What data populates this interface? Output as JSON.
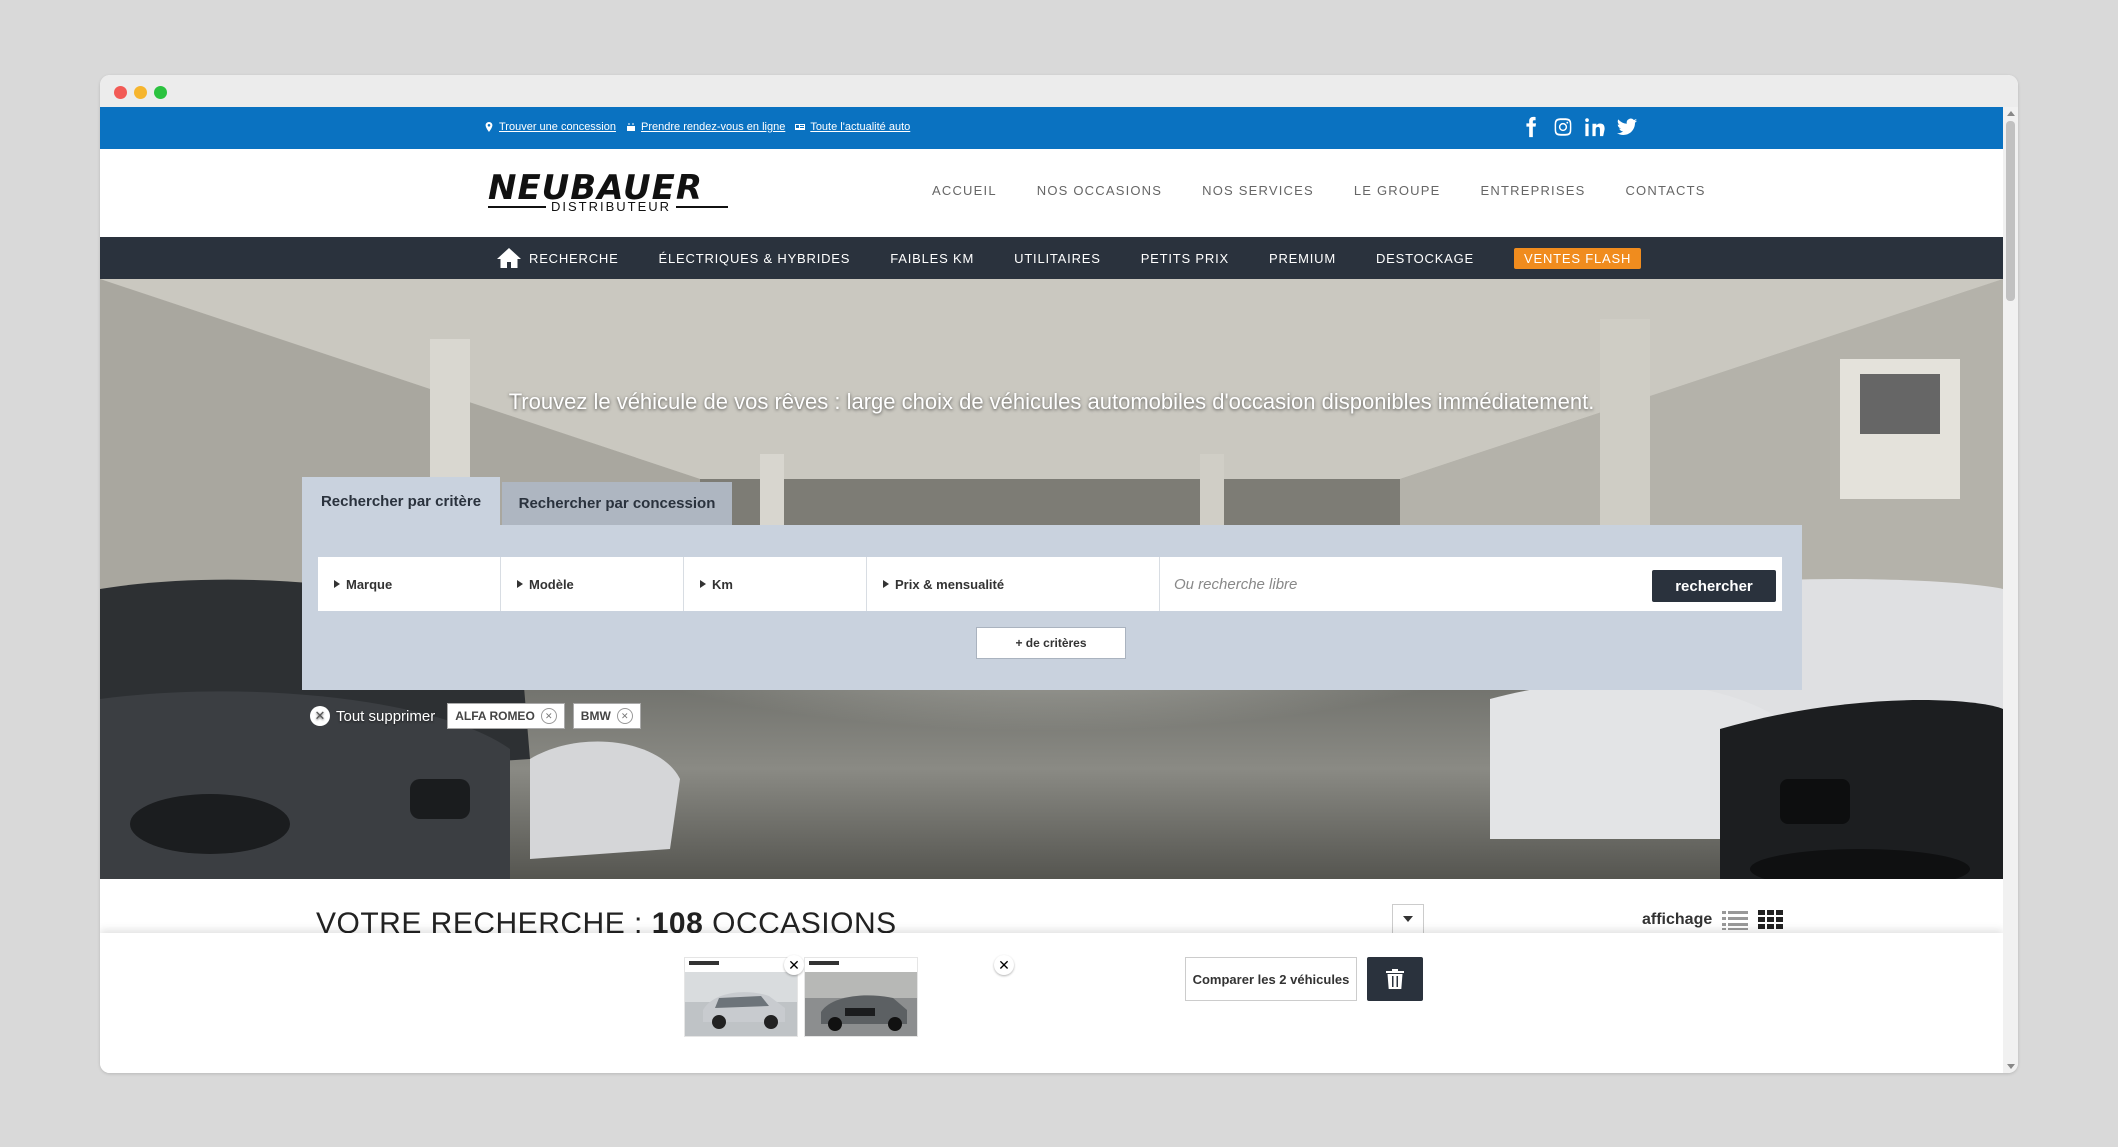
{
  "topbar": {
    "links": [
      {
        "label": "Trouver une concession",
        "icon": "map-pin-icon"
      },
      {
        "label": "Prendre rendez-vous en ligne",
        "icon": "calendar-icon"
      },
      {
        "label": "Toute l'actualité auto",
        "icon": "newspaper-icon"
      }
    ],
    "socials": [
      "facebook-icon",
      "instagram-icon",
      "linkedin-icon",
      "twitter-icon"
    ],
    "bg_color": "#0a72c1"
  },
  "header": {
    "logo_main": "NEUBAUER",
    "logo_sub": "DISTRIBUTEUR",
    "nav": [
      "ACCUEIL",
      "NOS OCCASIONS",
      "NOS SERVICES",
      "LE GROUPE",
      "ENTREPRISES",
      "CONTACTS"
    ]
  },
  "darknav": {
    "items": [
      "RECHERCHE",
      "ÉLECTRIQUES & HYBRIDES",
      "FAIBLES KM",
      "UTILITAIRES",
      "PETITS PRIX",
      "PREMIUM",
      "DESTOCKAGE"
    ],
    "flash": "VENTES FLASH",
    "flash_color": "#f08c1e",
    "bg_color": "#2a323d"
  },
  "hero": {
    "title": "Trouvez le véhicule de vos rêves : large choix de véhicules automobiles d'occasion disponibles immédiatement."
  },
  "search": {
    "tabs": {
      "active": "Rechercher par critère",
      "inactive": "Rechercher par concession"
    },
    "fields": [
      "Marque",
      "Modèle",
      "Km",
      "Prix & mensualité"
    ],
    "free_placeholder": "Ou recherche libre",
    "button": "rechercher",
    "more_button": "+ de critères"
  },
  "filters": {
    "clear_all": "Tout supprimer",
    "chips": [
      "ALFA ROMEO",
      "BMW"
    ]
  },
  "results": {
    "prefix": "VOTRE RECHERCHE : ",
    "count": "108",
    "suffix": " OCCASIONS",
    "display_label": "affichage"
  },
  "compare": {
    "button": "Comparer les 2 véhicules"
  }
}
